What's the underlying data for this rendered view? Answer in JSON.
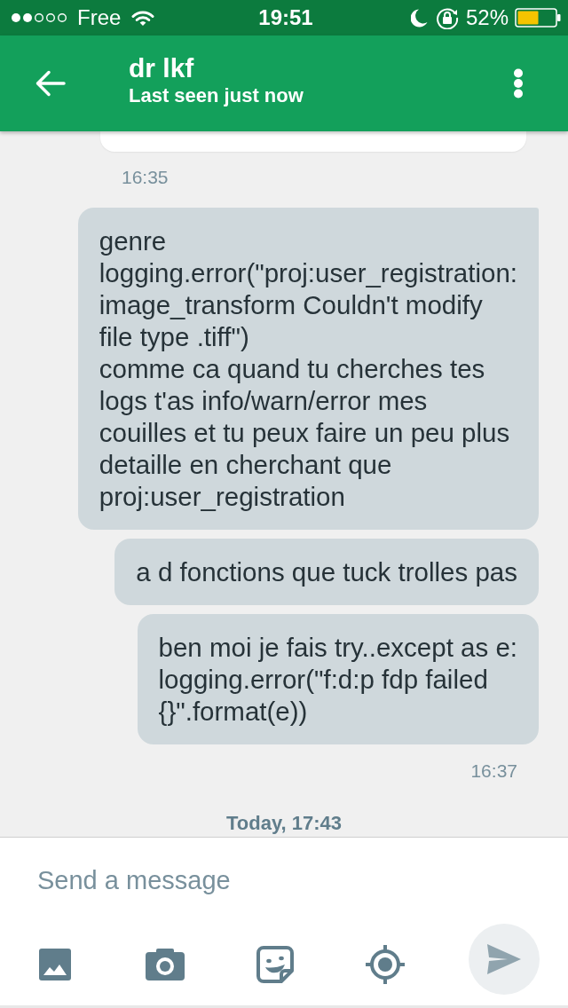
{
  "status_bar": {
    "carrier": "Free",
    "time": "19:51",
    "battery": "52%"
  },
  "header": {
    "title": "dr lkf",
    "subtitle": "Last seen just now"
  },
  "messages": [
    {
      "kind": "incoming"
    },
    {
      "kind": "time",
      "outgoing": false,
      "text": "16:35"
    },
    {
      "kind": "outgoing",
      "tail": true,
      "text": "genre\nlogging.error(\"proj:user_registration:\nimage_transform Couldn't modify\nfile type .tiff\")\ncomme ca quand tu cherches tes\nlogs t'as info/warn/error mes\ncouilles et tu peux faire un peu plus\ndetaille en cherchant que\nproj:user_registration"
    },
    {
      "kind": "outgoing",
      "tail": false,
      "text": "a d fonctions que tuck trolles pas"
    },
    {
      "kind": "outgoing",
      "tail": false,
      "text": "ben moi je fais try..except as e:\nlogging.error(\"f:d:p fdp failed\n{}\".format(e))"
    },
    {
      "kind": "time",
      "outgoing": true,
      "text": "16:37"
    },
    {
      "kind": "day",
      "text": "Today, 17:43"
    }
  ],
  "composer": {
    "placeholder": "Send a message"
  }
}
